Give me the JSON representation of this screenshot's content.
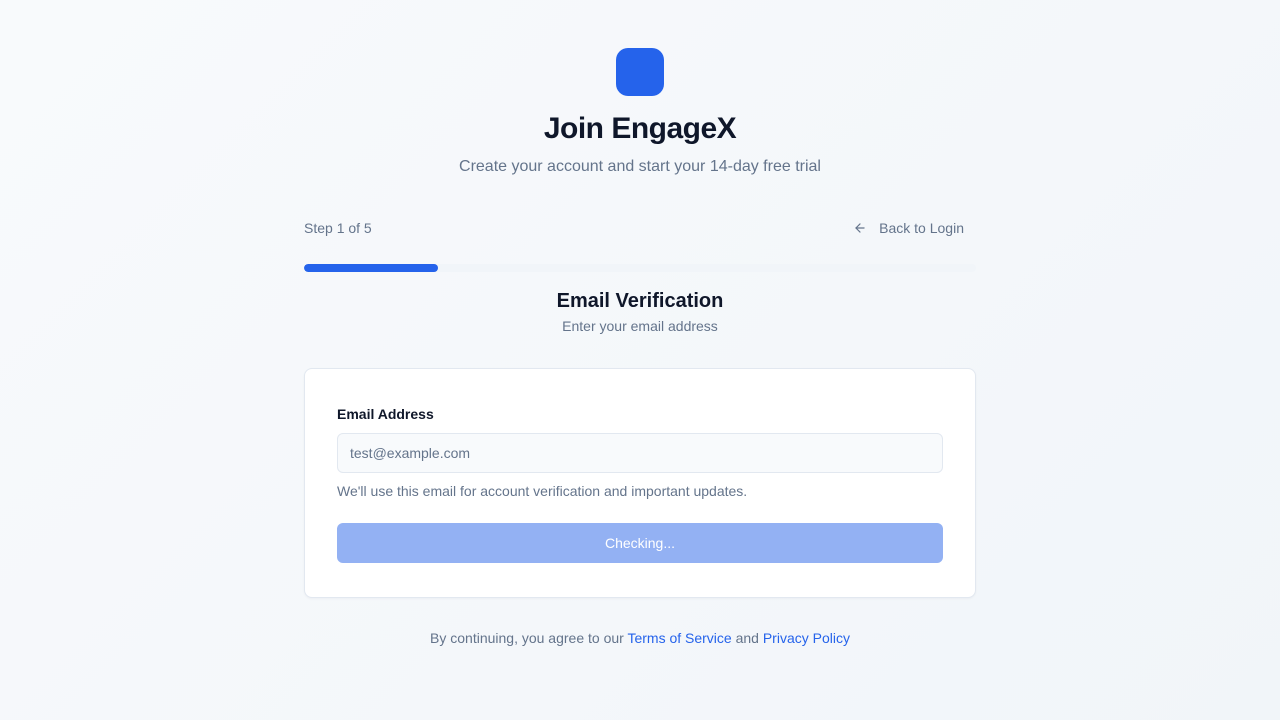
{
  "brand": {
    "accent_color": "#2563eb",
    "title": "Join EngageX",
    "subtitle": "Create your account and start your 14-day free trial"
  },
  "progress": {
    "step_label": "Step 1 of 5",
    "back_label": "Back to Login",
    "back_icon": "arrow-left-icon",
    "fraction": 0.2
  },
  "section": {
    "title": "Email Verification",
    "subtitle": "Enter your email address"
  },
  "form": {
    "email_label": "Email Address",
    "email_value": "",
    "email_placeholder": "test@example.com",
    "helper_text": "We'll use this email for account verification and important updates.",
    "submit_label": "Checking...",
    "submit_disabled": true
  },
  "footer": {
    "prefix": "By continuing, you agree to our ",
    "terms_label": "Terms of Service",
    "middle": " and ",
    "privacy_label": "Privacy Policy"
  }
}
